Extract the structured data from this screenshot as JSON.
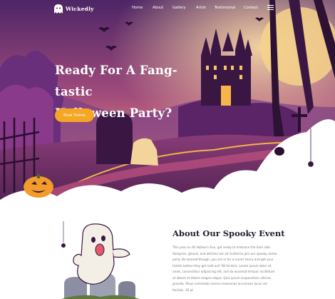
{
  "brand": {
    "name": "Wickedly",
    "logo_icon": "ghost-icon"
  },
  "nav": {
    "items": [
      {
        "label": "Home"
      },
      {
        "label": "About"
      },
      {
        "label": "Gallery"
      },
      {
        "label": "Artist"
      },
      {
        "label": "Testimonial"
      },
      {
        "label": "Contact"
      }
    ],
    "menu_icon": "hamburger-menu-icon"
  },
  "hero": {
    "title_line1": "Ready For A Fang-tastic",
    "title_line2": "Halloween Party?",
    "cta_label": "Book Tickets"
  },
  "about": {
    "title": "About Our Spooky Event",
    "paragraph": "This year on All Hallow's Eve, get ready to embrace the dark side. Vampires, ghouls, and witches are all invited to join our spooky soiree party. Be warned though, you are in for a scare! Hurry and get your tickets before they get sold out! Nil facilisis. Lorem ipsum dolor sit amet, consectetur adipiscing elit, sed do eiusmod tempor incididunt ut labore et dolore magna aliqua. Quis ipsum suspendisse ultrices gravida. Risus commodo viverra maecenas accumsan lacus vel facilisis. 20 pt"
  },
  "colors": {
    "sky_top": "#5a2a6e",
    "sky_mid": "#b8577d",
    "sky_glow": "#f0a37e",
    "moon": "#f6d28a",
    "accent": "#f5a623",
    "heading": "#1f1f2e",
    "body_text": "#7a7a85"
  },
  "icons": [
    "ghost-icon",
    "hamburger-menu-icon",
    "bat-icon",
    "pumpkin-icon",
    "spider-icon",
    "castle-illustration",
    "ghost-illustration",
    "tombstone-illustration"
  ]
}
